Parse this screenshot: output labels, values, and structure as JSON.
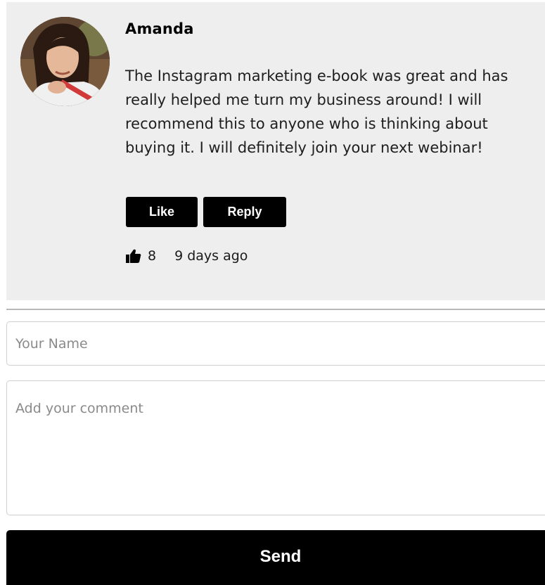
{
  "comment": {
    "author": "Amanda",
    "text": "The Instagram marketing e-book was great and has really helped me turn my business around! I will recommend this to anyone who is thinking about buying it. I will definitely join your next webinar!",
    "like_label": "Like",
    "reply_label": "Reply",
    "like_icon": "thumbs-up-icon",
    "like_count": "8",
    "timestamp": "9 days ago"
  },
  "form": {
    "name_placeholder": "Your Name",
    "comment_placeholder": "Add your comment",
    "send_label": "Send"
  },
  "colors": {
    "card_background": "#eeeeee",
    "button_background": "#000000",
    "button_text": "#ffffff"
  }
}
